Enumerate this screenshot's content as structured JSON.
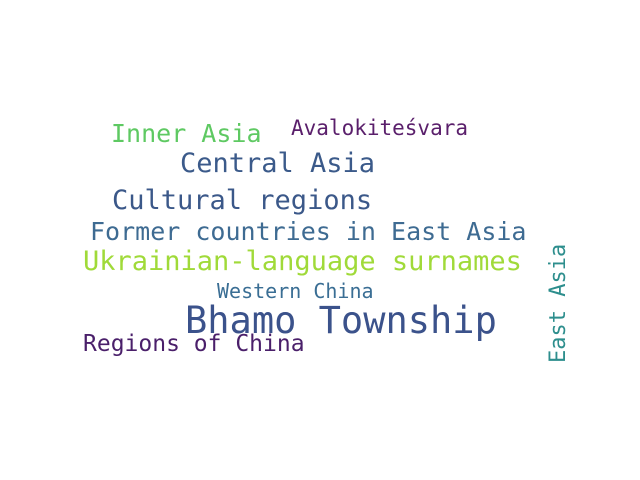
{
  "words": [
    {
      "text": "Bhamo Township",
      "color": "#3b528b"
    },
    {
      "text": "Ukrainian-language surnames",
      "color": "#a0da39"
    },
    {
      "text": "Former countries in East Asia",
      "color": "#3e6b92"
    },
    {
      "text": "Cultural regions",
      "color": "#3b5889"
    },
    {
      "text": "Central Asia",
      "color": "#3b5a8a"
    },
    {
      "text": "Inner Asia",
      "color": "#5ec962"
    },
    {
      "text": "Avalokiteśvara",
      "color": "#5a1f6b"
    },
    {
      "text": "Western China",
      "color": "#3a6e94"
    },
    {
      "text": "Regions of China",
      "color": "#4a1f6a"
    },
    {
      "text": "East Asia",
      "color": "#2d8e8d"
    }
  ],
  "background": "#ffffff"
}
